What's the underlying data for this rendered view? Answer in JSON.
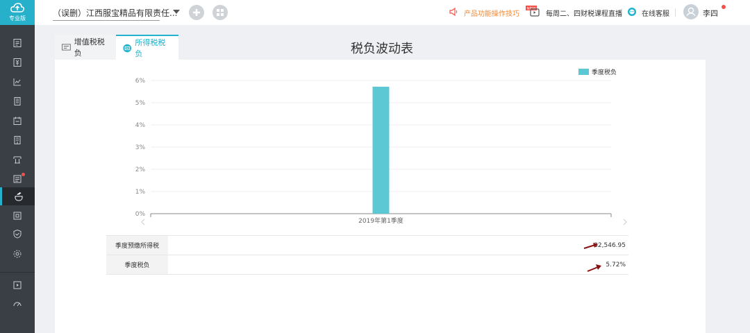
{
  "app": {
    "edition": "专业版"
  },
  "topbar": {
    "company": "（误删）江西服宝精品有限责任...",
    "tips_link": "产品功能操作技巧",
    "live_badge": "NEW",
    "live_text": "每周二、四财税课程直播",
    "customer_service": "在线客服",
    "user_name": "李四"
  },
  "tabs": [
    {
      "label": "增值税税负",
      "active": false
    },
    {
      "label": "所得税税负",
      "active": true
    }
  ],
  "page_title": "税负波动表",
  "chart_data": {
    "type": "bar",
    "categories": [
      "2019年第1季度"
    ],
    "series": [
      {
        "name": "季度税负",
        "values": [
          5.72
        ],
        "color": "#5bc8d3"
      }
    ],
    "y_ticks": [
      "0%",
      "1%",
      "2%",
      "3%",
      "4%",
      "5%",
      "6%"
    ],
    "ylim": [
      0,
      6
    ],
    "grid": true,
    "legend": "top-right"
  },
  "table": {
    "rows": [
      {
        "label": "季度预缴所得税",
        "value": "32,546.95"
      },
      {
        "label": "季度税负",
        "value": "5.72%"
      }
    ]
  },
  "colors": {
    "accent": "#1fb3cc",
    "bar": "#5bc8d3",
    "alert": "#f2524a",
    "tip": "#f08a3a"
  }
}
